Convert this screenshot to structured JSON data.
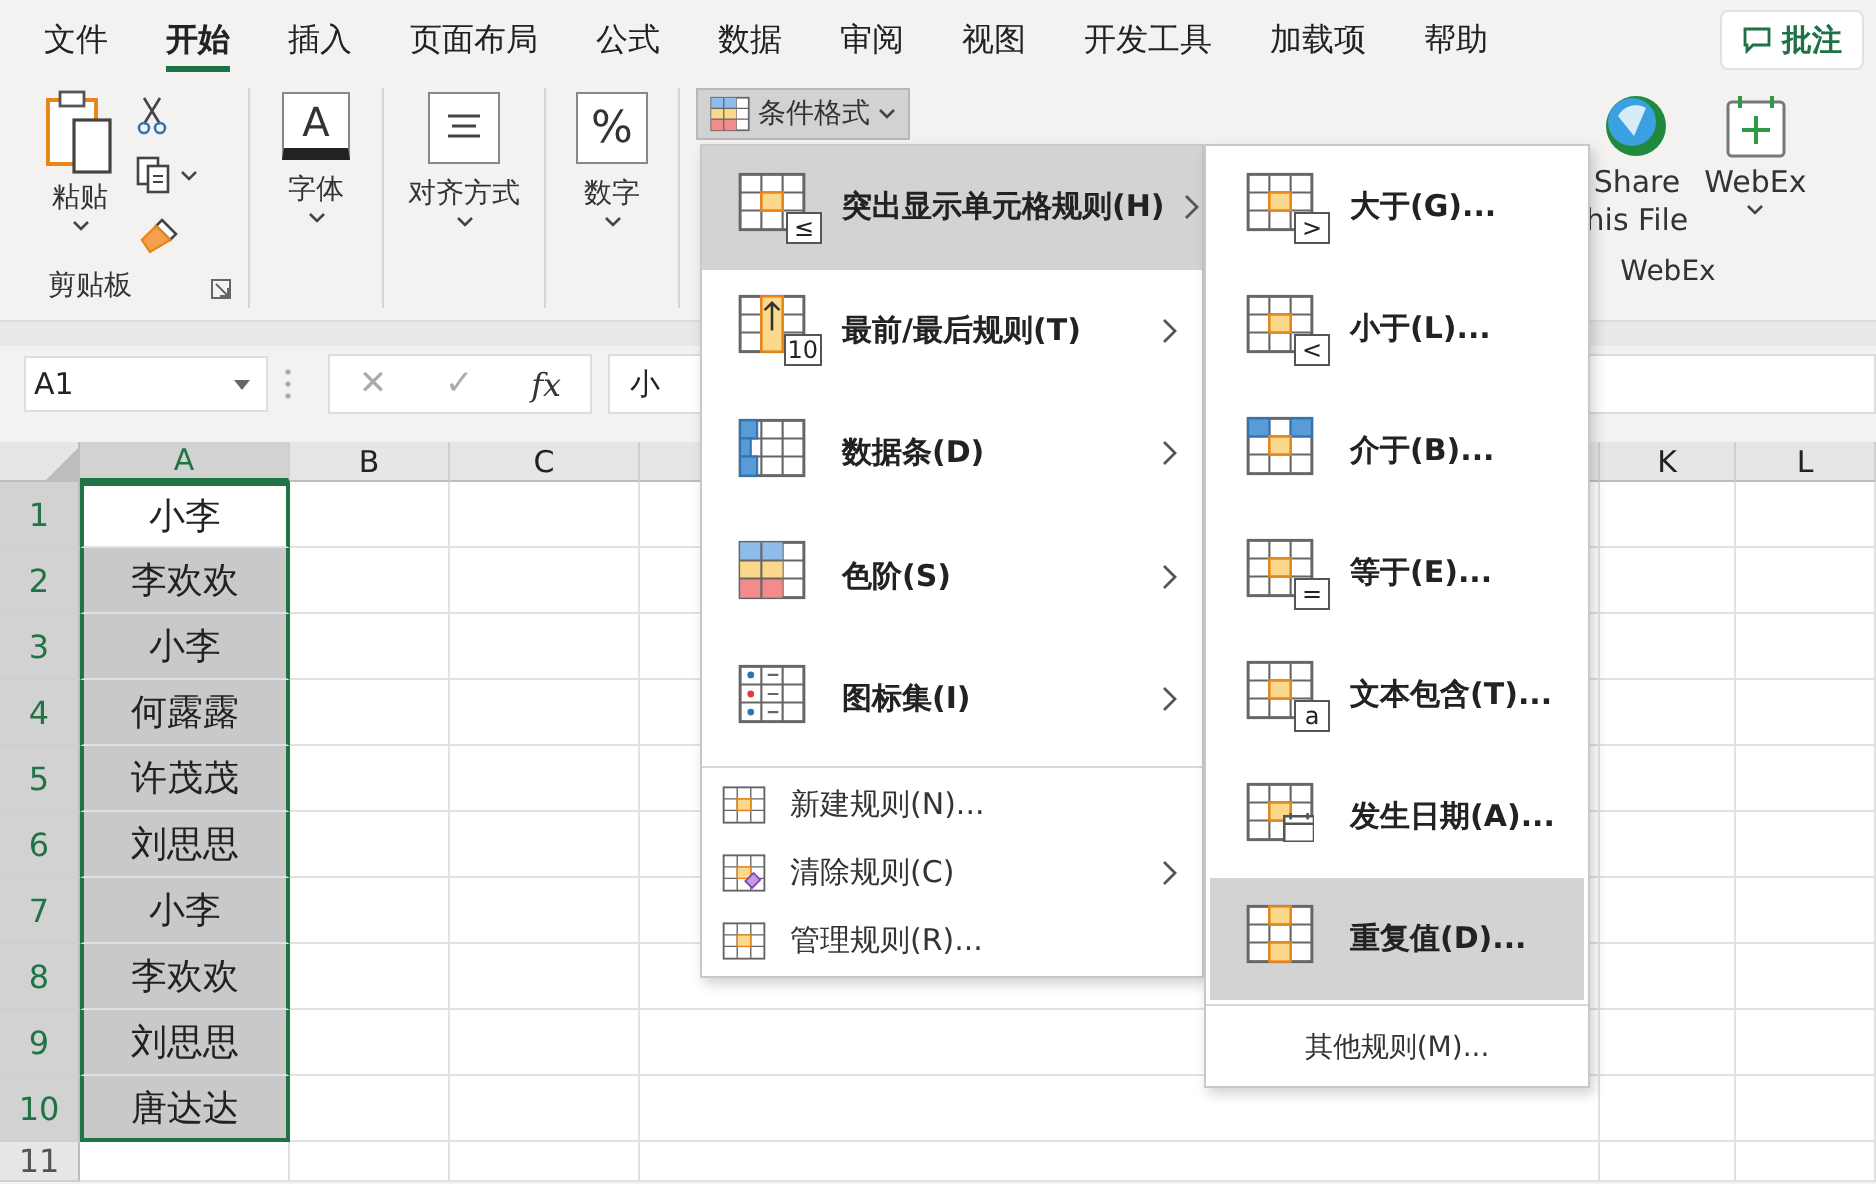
{
  "tabs": [
    {
      "label": "文件",
      "selected": false
    },
    {
      "label": "开始",
      "selected": true
    },
    {
      "label": "插入",
      "selected": false
    },
    {
      "label": "页面布局",
      "selected": false
    },
    {
      "label": "公式",
      "selected": false
    },
    {
      "label": "数据",
      "selected": false
    },
    {
      "label": "审阅",
      "selected": false
    },
    {
      "label": "视图",
      "selected": false
    },
    {
      "label": "开发工具",
      "selected": false
    },
    {
      "label": "加载项",
      "selected": false
    },
    {
      "label": "帮助",
      "selected": false
    }
  ],
  "comments_button": {
    "label": "批注"
  },
  "ribbon": {
    "clipboard": {
      "paste": "粘贴",
      "group": "剪贴板"
    },
    "buttons": [
      {
        "glyph": "A",
        "label": "字体"
      },
      {
        "label": "对齐方式"
      },
      {
        "glyph": "%",
        "label": "数字"
      }
    ],
    "conditional_format": {
      "label": "条件格式",
      "pressed": true
    },
    "share": {
      "lines": [
        "Share",
        "his File"
      ]
    },
    "webex": {
      "label": "WebEx",
      "group": "WebEx"
    }
  },
  "formula_bar": {
    "name_box": "A1",
    "cancel": "✕",
    "enter": "✓",
    "fx": "fx",
    "value": "小"
  },
  "sheet": {
    "columns_left": [
      {
        "label": "A",
        "selected": true
      },
      {
        "label": "B",
        "selected": false
      },
      {
        "label": "C",
        "selected": false
      }
    ],
    "columns_right": [
      {
        "label": "K",
        "selected": false
      },
      {
        "label": "L",
        "selected": false
      }
    ],
    "rows": [
      {
        "number": "1",
        "value": "小李",
        "selected": true,
        "active": true
      },
      {
        "number": "2",
        "value": "李欢欢",
        "selected": true,
        "active": false
      },
      {
        "number": "3",
        "value": "小李",
        "selected": true,
        "active": false
      },
      {
        "number": "4",
        "value": "何露露",
        "selected": true,
        "active": false
      },
      {
        "number": "5",
        "value": "许茂茂",
        "selected": true,
        "active": false
      },
      {
        "number": "6",
        "value": "刘思思",
        "selected": true,
        "active": false
      },
      {
        "number": "7",
        "value": "小李",
        "selected": true,
        "active": false
      },
      {
        "number": "8",
        "value": "李欢欢",
        "selected": true,
        "active": false
      },
      {
        "number": "9",
        "value": "刘思思",
        "selected": true,
        "active": false
      },
      {
        "number": "10",
        "value": "唐达达",
        "selected": true,
        "active": false
      },
      {
        "number": "11",
        "selected": false,
        "active": false
      }
    ]
  },
  "menu": {
    "items": [
      {
        "kind": "large",
        "label": "突出显示单元格规则(H)",
        "badge": "≤",
        "submenu": true,
        "selected": true
      },
      {
        "kind": "large",
        "label": "最前/最后规则(T)",
        "badge": "10",
        "submenu": true,
        "selected": false
      },
      {
        "kind": "large",
        "label": "数据条(D)",
        "submenu": true,
        "selected": false
      },
      {
        "kind": "large",
        "label": "色阶(S)",
        "submenu": true,
        "selected": false
      },
      {
        "kind": "large",
        "label": "图标集(I)",
        "submenu": true,
        "selected": false
      },
      {
        "kind": "small",
        "label": "新建规则(N)...",
        "submenu": false,
        "selected": false
      },
      {
        "kind": "small",
        "label": "清除规则(C)",
        "submenu": true,
        "selected": false
      },
      {
        "kind": "small",
        "label": "管理规则(R)...",
        "submenu": false,
        "selected": false
      }
    ]
  },
  "submenu": {
    "items": [
      {
        "label": "大于(G)...",
        "badge": ">",
        "selected": false
      },
      {
        "label": "小于(L)...",
        "badge": "<",
        "selected": false
      },
      {
        "label": "介于(B)...",
        "selected": false
      },
      {
        "label": "等于(E)...",
        "badge": "=",
        "selected": false
      },
      {
        "label": "文本包含(T)...",
        "badge": "a",
        "selected": false
      },
      {
        "label": "发生日期(A)...",
        "selected": false
      },
      {
        "label": "重复值(D)...",
        "selected": true
      }
    ],
    "footer": "其他规则(M)..."
  }
}
